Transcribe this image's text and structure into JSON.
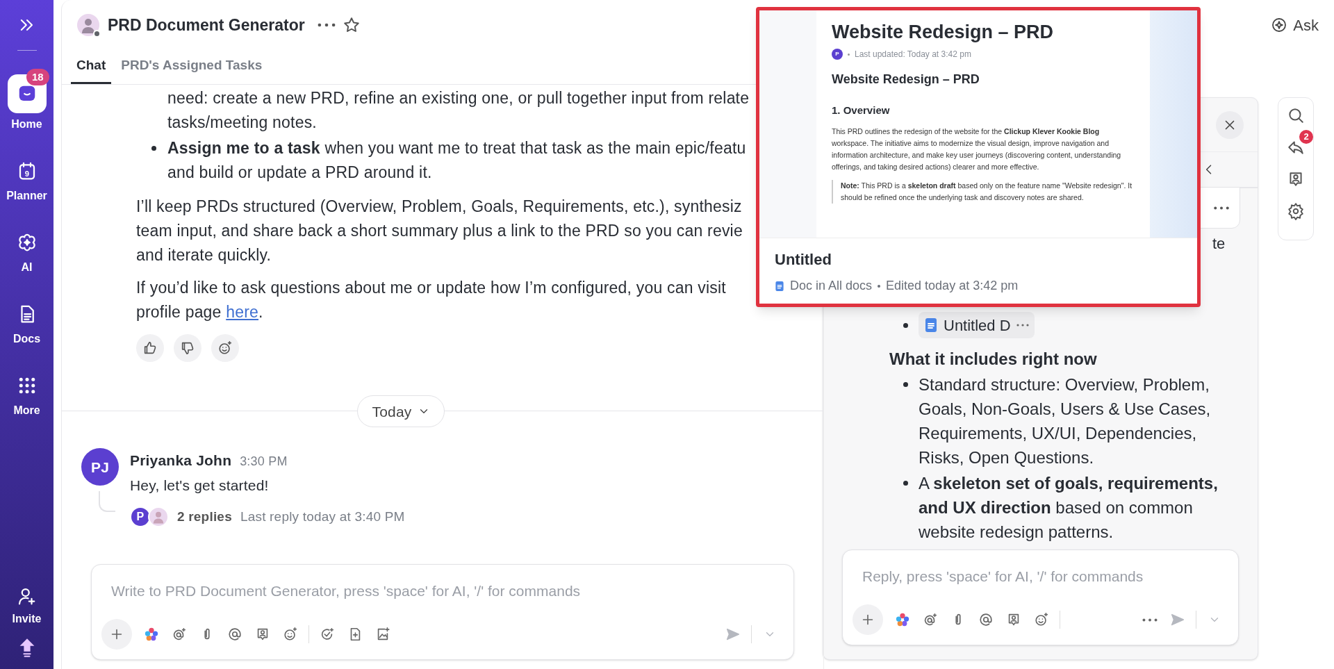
{
  "sidebar": {
    "items": [
      {
        "kind": "home",
        "label": "Home",
        "badge": "18",
        "selected": true
      },
      {
        "kind": "planner",
        "label": "Planner",
        "day": "9",
        "selected": false
      },
      {
        "kind": "ai",
        "label": "AI",
        "selected": false
      },
      {
        "kind": "docs",
        "label": "Docs",
        "selected": false
      },
      {
        "kind": "more",
        "label": "More",
        "selected": false
      }
    ],
    "invite": "Invite"
  },
  "header": {
    "title": "PRD Document Generator",
    "ask": "Ask"
  },
  "tabs": [
    {
      "label": "Chat",
      "selected": true
    },
    {
      "label": "PRD's Assigned Tasks",
      "selected": false
    }
  ],
  "chat": {
    "blocks": [
      {
        "kind": "continued",
        "lines": [
          "need: create a new PRD, refine an existing one, or pull together input from relate",
          "tasks/meeting notes."
        ]
      },
      {
        "kind": "bullet",
        "lines": [
          "**Assign me to a task** when you want me to treat that task as the main epic/featu",
          "and build or update a PRD around it."
        ]
      },
      {
        "kind": "paragraph",
        "lines": [
          "I’ll keep PRDs structured (Overview, Problem, Goals, Requirements, etc.), synthesiz",
          "team input, and share back a short summary plus a link to the PRD so you can revie",
          "and iterate quickly."
        ]
      },
      {
        "kind": "paragraph",
        "lines": [
          "If you’d like to ask questions about me or update how I’m configured, you can visit",
          "profile page "
        ],
        "link": "here",
        "after_link": "."
      }
    ],
    "date_divider": "Today",
    "messages": [
      {
        "initials": "PJ",
        "author": "Priyanka John",
        "time": "3:30 PM",
        "text": "Hey, let's get started!",
        "reply_initial": "P",
        "reply_count": "2 replies",
        "last_reply": "Last reply today at 3:40 PM"
      }
    ],
    "composer": {
      "placeholder": "Write to PRD Document Generator, press 'space' for AI, '/' for commands"
    }
  },
  "preview": {
    "doc_title": "Website Redesign – PRD",
    "author_initial": "P",
    "updated": "Last updated: Today at 3:42 pm",
    "heading": "Website Redesign – PRD",
    "section": "1. Overview",
    "body": "This PRD outlines the redesign of the website for the **Clickup Klever Kookie Blog** workspace. The initiative aims to modernize the visual design, improve navigation and information architecture, and make key user journeys (discovering content, understanding offerings, and taking desired actions) clearer and more effective.",
    "note": "**Note:** This PRD is a **skeleton draft** based only on the feature name \"Website redesign\". It should be refined once the underlying task and discovery notes are shared.",
    "name": "Untitled",
    "location": "Doc in All docs",
    "edited": "Edited today at 3:42 pm"
  },
  "thread": {
    "fragment": "te",
    "file_chip": "Untitled D",
    "heading": "What it includes right now",
    "bullets": [
      "Standard structure: Overview, Problem, Goals, Non-Goals, Users & Use Cases, Requirements, UX/UI, Dependencies, Risks, Open Questions.",
      "A **skeleton set of goals, requirements, and UX direction** based on common website redesign patterns."
    ],
    "composer": {
      "placeholder": "Reply, press 'space' for AI, '/' for commands"
    }
  },
  "rail": {
    "reply_badge": "2"
  }
}
